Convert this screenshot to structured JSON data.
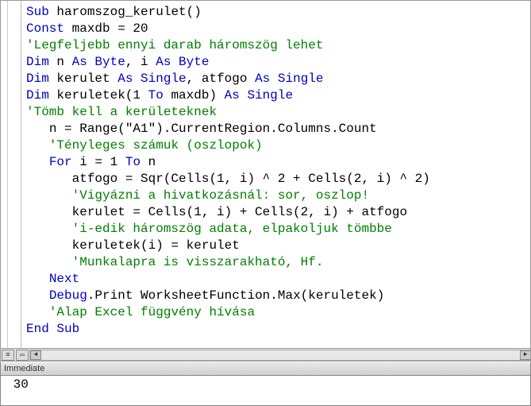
{
  "code": {
    "lines": [
      {
        "type": "mixed",
        "tokens": [
          [
            "kw",
            "Sub"
          ],
          [
            "txt",
            " haromszog_kerulet()"
          ]
        ]
      },
      {
        "type": "mixed",
        "tokens": [
          [
            "kw",
            "Const"
          ],
          [
            "txt",
            " maxdb = 20"
          ]
        ]
      },
      {
        "type": "cm",
        "text": "'Legfeljebb ennyi darab háromszög lehet"
      },
      {
        "type": "mixed",
        "tokens": [
          [
            "kw",
            "Dim"
          ],
          [
            "txt",
            " n "
          ],
          [
            "kw",
            "As Byte"
          ],
          [
            "txt",
            ", i "
          ],
          [
            "kw",
            "As Byte"
          ]
        ]
      },
      {
        "type": "mixed",
        "tokens": [
          [
            "kw",
            "Dim"
          ],
          [
            "txt",
            " kerulet "
          ],
          [
            "kw",
            "As Single"
          ],
          [
            "txt",
            ", atfogo "
          ],
          [
            "kw",
            "As Single"
          ]
        ]
      },
      {
        "type": "mixed",
        "tokens": [
          [
            "kw",
            "Dim"
          ],
          [
            "txt",
            " keruletek(1 "
          ],
          [
            "kw",
            "To"
          ],
          [
            "txt",
            " maxdb) "
          ],
          [
            "kw",
            "As Single"
          ]
        ]
      },
      {
        "type": "cm",
        "text": "'Tömb kell a kerületeknek"
      },
      {
        "type": "mixed",
        "indent": 1,
        "tokens": [
          [
            "txt",
            "n = Range(\"A1\").CurrentRegion.Columns.Count"
          ]
        ]
      },
      {
        "type": "cm",
        "indent": 1,
        "text": "'Tényleges számuk (oszlopok)"
      },
      {
        "type": "mixed",
        "indent": 1,
        "tokens": [
          [
            "kw",
            "For"
          ],
          [
            "txt",
            " i = 1 "
          ],
          [
            "kw",
            "To"
          ],
          [
            "txt",
            " n"
          ]
        ]
      },
      {
        "type": "mixed",
        "indent": 2,
        "tokens": [
          [
            "txt",
            "atfogo = Sqr(Cells(1, i) ^ 2 + Cells(2, i) ^ 2)"
          ]
        ]
      },
      {
        "type": "cm",
        "indent": 2,
        "text": "'Vigyázni a hivatkozásnál: sor, oszlop!"
      },
      {
        "type": "mixed",
        "indent": 2,
        "tokens": [
          [
            "txt",
            "kerulet = Cells(1, i) + Cells(2, i) + atfogo"
          ]
        ]
      },
      {
        "type": "cm",
        "indent": 2,
        "text": "'i-edik háromszög adata, elpakoljuk tömbbe"
      },
      {
        "type": "mixed",
        "indent": 2,
        "tokens": [
          [
            "txt",
            "keruletek(i) = kerulet"
          ]
        ]
      },
      {
        "type": "cm",
        "indent": 2,
        "text": "'Munkalapra is visszarakható, Hf."
      },
      {
        "type": "mixed",
        "indent": 1,
        "tokens": [
          [
            "kw",
            "Next"
          ]
        ]
      },
      {
        "type": "mixed",
        "indent": 1,
        "tokens": [
          [
            "kw",
            "Debug"
          ],
          [
            "txt",
            ".Print WorksheetFunction.Max(keruletek)"
          ]
        ]
      },
      {
        "type": "cm",
        "indent": 1,
        "text": "'Alap Excel függvény hívása"
      },
      {
        "type": "mixed",
        "tokens": [
          [
            "kw",
            "End Sub"
          ]
        ]
      }
    ]
  },
  "immediate": {
    "title": "Immediate",
    "output": " 30 "
  },
  "scroll": {
    "left_arrow": "◄",
    "right_arrow": "►"
  }
}
